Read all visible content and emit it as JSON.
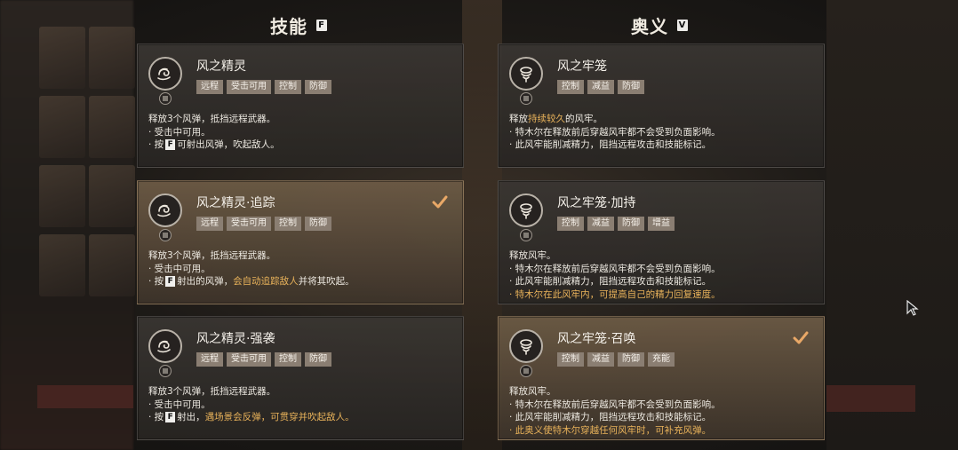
{
  "skills": {
    "title": "技能",
    "key": "F",
    "cards": [
      {
        "title": "风之精灵",
        "tags": [
          "远程",
          "受击可用",
          "控制",
          "防御"
        ],
        "selected": false,
        "lines": [
          {
            "text": "释放3个风弹，抵挡远程武器。"
          },
          {
            "text": "· 受击中可用。"
          },
          {
            "pre": "· 按",
            "key": "F",
            "post": "可射出风弹，吹起敌人。"
          }
        ]
      },
      {
        "title": "风之精灵·追踪",
        "tags": [
          "远程",
          "受击可用",
          "控制",
          "防御"
        ],
        "selected": true,
        "lines": [
          {
            "text": "释放3个风弹，抵挡远程武器。"
          },
          {
            "text": "· 受击中可用。"
          },
          {
            "pre": "· 按",
            "key": "F",
            "post": "射出的风弹，",
            "hl": "会自动追踪敌人",
            "post2": "并将其吹起。"
          }
        ]
      },
      {
        "title": "风之精灵·强袭",
        "tags": [
          "远程",
          "受击可用",
          "控制",
          "防御"
        ],
        "selected": false,
        "lines": [
          {
            "text": "释放3个风弹，抵挡远程武器。"
          },
          {
            "text": "· 受击中可用。"
          },
          {
            "pre": "· 按",
            "key": "F",
            "post": "射出，",
            "hl": "遇场景会反弹，可贯穿并吹起敌人。"
          }
        ]
      }
    ]
  },
  "ultimates": {
    "title": "奥义",
    "key": "V",
    "cards": [
      {
        "title": "风之牢笼",
        "tags": [
          "控制",
          "减益",
          "防御"
        ],
        "selected": false,
        "lines": [
          {
            "pre": "释放",
            "hl": "持续较久",
            "post": "的风牢。"
          },
          {
            "text": "· 特木尔在释放前后穿越风牢都不会受到负面影响。"
          },
          {
            "text": "· 此风牢能削减精力，阻挡远程攻击和技能标记。"
          }
        ]
      },
      {
        "title": "风之牢笼·加持",
        "tags": [
          "控制",
          "减益",
          "防御",
          "增益"
        ],
        "selected": false,
        "lines": [
          {
            "text": "释放风牢。"
          },
          {
            "text": "· 特木尔在释放前后穿越风牢都不会受到负面影响。"
          },
          {
            "text": "· 此风牢能削减精力，阻挡远程攻击和技能标记。"
          },
          {
            "text": "· 特木尔在此风牢内，可提高自己的精力回复速度。",
            "highlight": true
          }
        ]
      },
      {
        "title": "风之牢笼·召唤",
        "tags": [
          "控制",
          "减益",
          "防御",
          "充能"
        ],
        "selected": true,
        "lines": [
          {
            "text": "释放风牢。"
          },
          {
            "text": "· 特木尔在释放前后穿越风牢都不会受到负面影响。"
          },
          {
            "text": "· 此风牢能削减精力，阻挡远程攻击和技能标记。"
          },
          {
            "text": "· 此奥义使特木尔穿越任何风牢时，可补充风弹。",
            "highlight": true
          }
        ]
      }
    ]
  },
  "colors": {
    "accent": "#e8b25a",
    "tag_bg": "#8a7e72",
    "check": "#e9a867"
  }
}
